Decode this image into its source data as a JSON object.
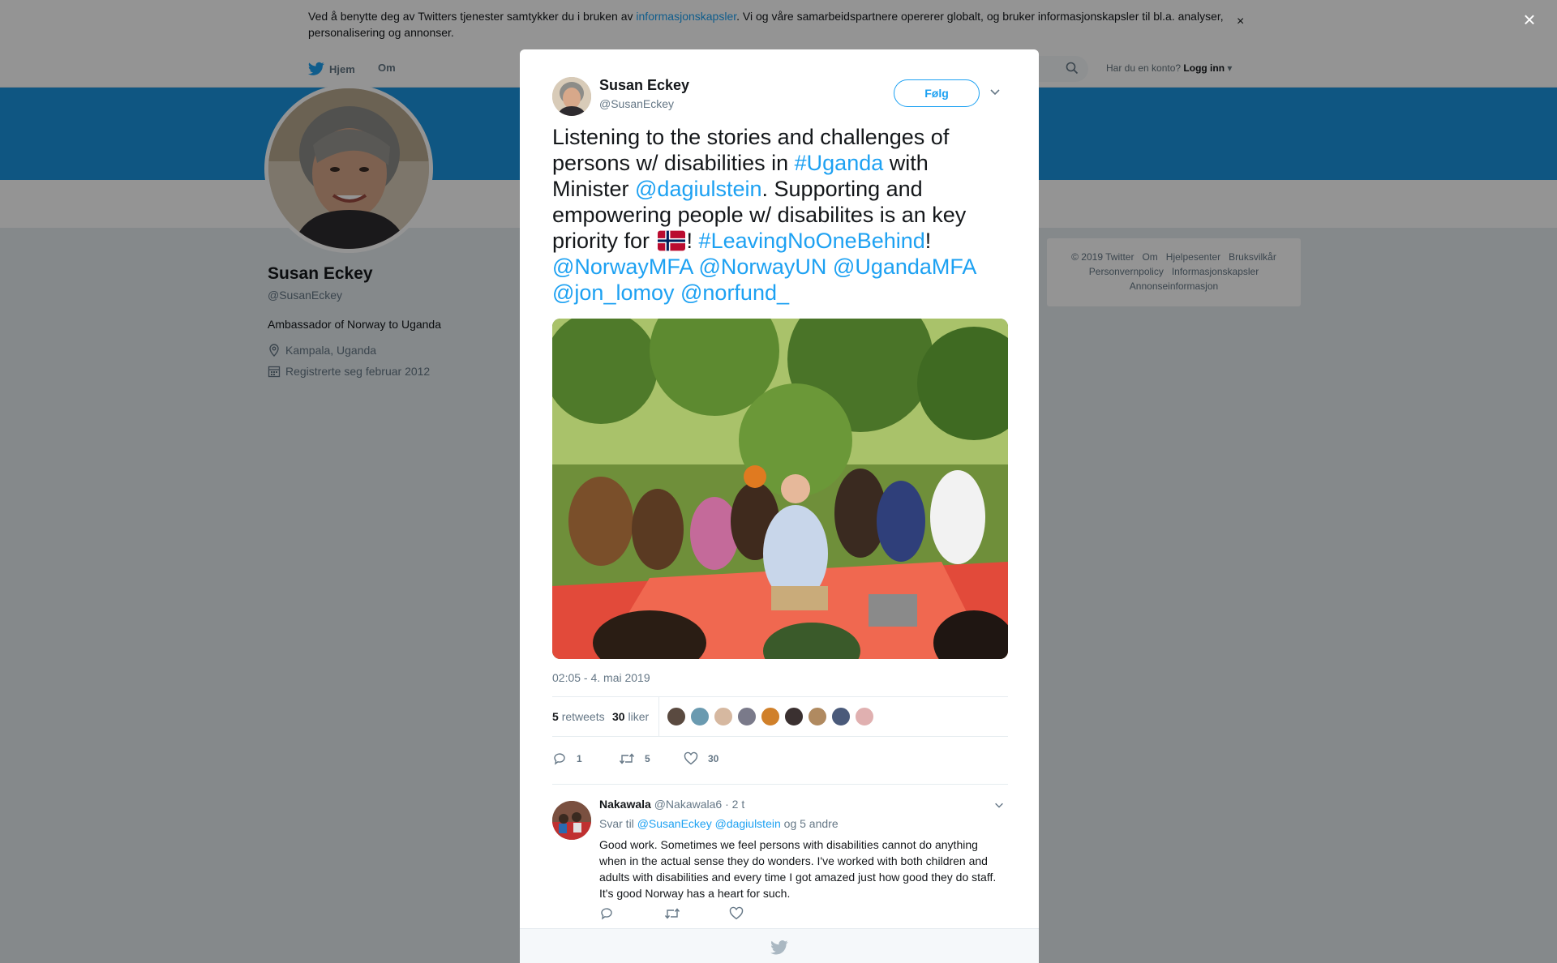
{
  "cookie": {
    "text_before": "Ved å benytte deg av Twitters tjenester samtykker du i bruken av ",
    "link": "informasjonskapsler",
    "text_after": ". Vi og våre samarbeidspartnere opererer globalt, og bruker informasjonskapsler til bl.a. analyser, personalisering og annonser.",
    "close": "×"
  },
  "nav": {
    "home": "Hjem",
    "about": "Om",
    "account_prompt": "Har du en konto?",
    "login": "Logg inn"
  },
  "profile": {
    "name": "Susan Eckey",
    "handle": "@SusanEckey",
    "bio": "Ambassador of Norway to Uganda",
    "location": "Kampala, Uganda",
    "joined": "Registrerte seg februar 2012"
  },
  "footer": {
    "links": [
      "© 2019 Twitter",
      "Om",
      "Hjelpesenter",
      "Bruksvilkår",
      "Personvernpolicy",
      "Informasjonskapsler",
      "Annonseinformasjon"
    ]
  },
  "overlay": {
    "close": "×"
  },
  "tweet": {
    "name": "Susan Eckey",
    "handle": "@SusanEckey",
    "follow": "Følg",
    "text": {
      "p1": "Listening to the stories and challenges of persons w/ disabilities in ",
      "hashtag1": "#Uganda",
      "p2": " with Minister ",
      "mention1": "@dagiulstein",
      "p3": ". Supporting and empowering people w/ disabilites is an key priority for ",
      "p4": "! ",
      "hashtag2": "#LeavingNoOneBehind",
      "p5": "!",
      "mentions": [
        "@NorwayMFA",
        "@NorwayUN",
        "@UgandaMFA",
        "@jon_lomoy",
        "@norfund_"
      ]
    },
    "timestamp": "02:05 - 4. mai 2019",
    "retweets_count": "5",
    "retweets_label": "retweets",
    "likes_count": "30",
    "likes_label": "liker",
    "actions": {
      "replies": "1",
      "retweets": "5",
      "likes": "30"
    }
  },
  "reply": {
    "name": "Nakawala",
    "handle": "@Nakawala6",
    "time": "· 2 t",
    "to_label": "Svar til",
    "to_mentions": "@SusanEckey @dagiulstein",
    "to_others": "og 5 andre",
    "text": "Good work. Sometimes we feel persons with disabilities cannot do anything when in the actual sense they do wonders. I've worked with both children and adults with disabilities and every time I got amazed just how good they do staff. It's good Norway has a heart for such."
  },
  "colors": {
    "brand": "#1da1f2",
    "banner": "#1b95e0",
    "text": "#14171a",
    "secondary_text": "#657786",
    "background": "#e6ecf0"
  },
  "icons": [
    "twitter-bird-icon",
    "search-icon",
    "location-icon",
    "calendar-icon",
    "close-icon",
    "chevron-down-icon",
    "reply-icon",
    "retweet-icon",
    "like-icon",
    "norway-flag-icon"
  ]
}
